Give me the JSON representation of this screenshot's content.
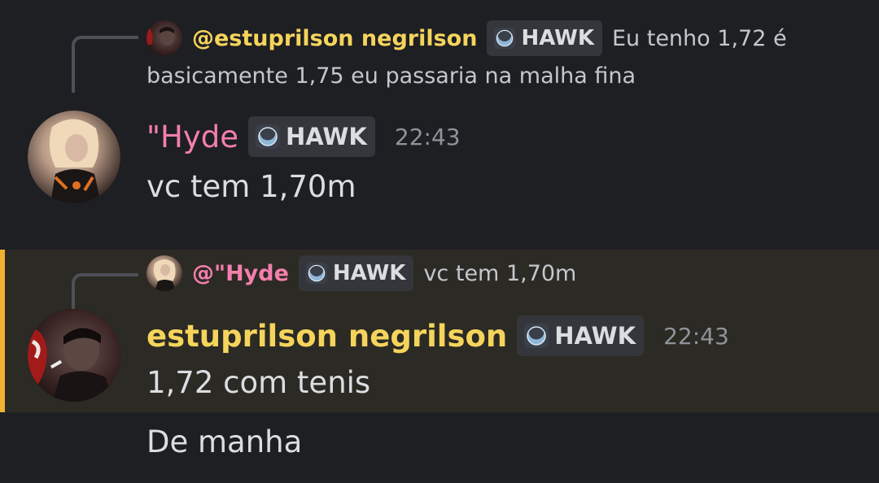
{
  "messages": [
    {
      "reply": {
        "author": "@estuprilson negrilson",
        "tag": "HAWK",
        "text_line1": "Eu tenho 1,72 é",
        "text_line2": "basicamente 1,75 eu passaria na malha fina"
      },
      "author": "\"Hyde",
      "tag": "HAWK",
      "timestamp": "22:43",
      "text": "vc tem 1,70m"
    },
    {
      "reply": {
        "author": "@\"Hyde",
        "tag": "HAWK",
        "text": "vc tem 1,70m"
      },
      "author": "estuprilson negrilson",
      "tag": "HAWK",
      "timestamp": "22:43",
      "text": "1,72 com tenis",
      "followup": "De manha"
    }
  ],
  "colors": {
    "background": "#1e1f23",
    "highlight_bg": "#2c2a24",
    "highlight_bar": "#f0b232",
    "hyde_name": "#f47fad",
    "estuprilson_name": "#f5d45c",
    "tag_bg": "#34363b",
    "timestamp": "#8f939a"
  },
  "icons": [
    "hawk-moon-icon"
  ]
}
